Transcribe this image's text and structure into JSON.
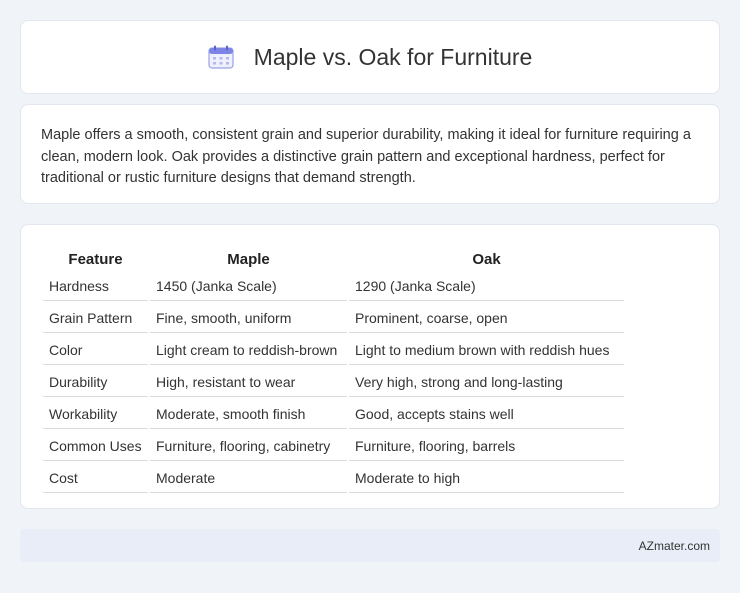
{
  "header": {
    "title": "Maple vs. Oak for Furniture",
    "icon": "calendar-icon"
  },
  "intro": {
    "text": "Maple offers a smooth, consistent grain and superior durability, making it ideal for furniture requiring a clean, modern look. Oak provides a distinctive grain pattern and exceptional hardness, perfect for traditional or rustic furniture designs that demand strength."
  },
  "table": {
    "columns": [
      "Feature",
      "Maple",
      "Oak"
    ],
    "rows": [
      [
        "Hardness",
        "1450 (Janka Scale)",
        "1290 (Janka Scale)"
      ],
      [
        "Grain Pattern",
        "Fine, smooth, uniform",
        "Prominent, coarse, open"
      ],
      [
        "Color",
        "Light cream to reddish-brown",
        "Light to medium brown with reddish hues"
      ],
      [
        "Durability",
        "High, resistant to wear",
        "Very high, strong and long-lasting"
      ],
      [
        "Workability",
        "Moderate, smooth finish",
        "Good, accepts stains well"
      ],
      [
        "Common Uses",
        "Furniture, flooring, cabinetry",
        "Furniture, flooring, barrels"
      ],
      [
        "Cost",
        "Moderate",
        "Moderate to high"
      ]
    ]
  },
  "footer": {
    "brand": "AZmater.com"
  },
  "colors": {
    "background": "#f0f3f8",
    "card": "#ffffff",
    "footer": "#e8edf7",
    "icon_accent": "#6b72e0"
  }
}
